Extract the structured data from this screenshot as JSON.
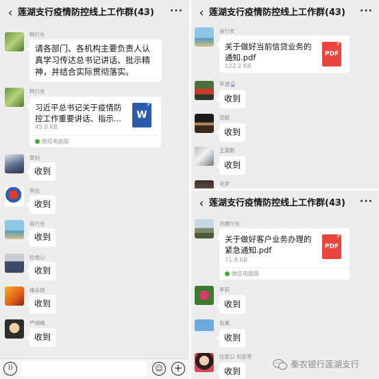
{
  "chat_title": "莲湖支行疫情防控线上工作群(43)",
  "icons": {
    "back": "chevron-left-icon",
    "mute": "mute-bell-icon",
    "more": "more-dots-icon",
    "voice": "voice-icon",
    "emoji": "emoji-icon",
    "plus": "plus-icon",
    "word_file": "word-file-icon",
    "pdf_file": "pdf-file-icon",
    "wechat_pc": "wechat-pc-icon"
  },
  "colors": {
    "chat_background": "#ededed",
    "bubble": "#ffffff",
    "pdf_red": "#e8453c",
    "word_blue": "#2b5cab",
    "wechat_green": "#3cb034"
  },
  "left_panel": {
    "messages": [
      {
        "sender": "韩行长",
        "text": "请各部门、各机构主要负责人认真学习传达总书记讲话、批示精神，并结合实际贯彻落实。"
      },
      {
        "sender": "韩行长",
        "file": {
          "name": "习近平总书记关于疫情防控工作重要讲话、指示...",
          "size": "45.0 KB",
          "icon_label": "W",
          "source": "微信电脑版"
        }
      },
      {
        "sender": "黄钊",
        "text": "收到"
      },
      {
        "sender": "李欣",
        "text": "收到"
      },
      {
        "sender": "容行长",
        "text": "收到"
      },
      {
        "sender": "杜岐山",
        "text": "收到"
      },
      {
        "sender": "褚永刚",
        "text": "收到"
      },
      {
        "sender": "严旭峰",
        "text": "收到"
      }
    ]
  },
  "right_top_panel": {
    "messages": [
      {
        "sender": "容行长",
        "file": {
          "name": "关于做好当前信贷业务的通知.pdf",
          "size": "122.2 KB",
          "icon_label": "PDF"
        }
      },
      {
        "sender": "毕波🎡",
        "text": "收到"
      },
      {
        "sender": "党超",
        "text": "收到"
      },
      {
        "sender": "王震鹏",
        "text": "收到"
      },
      {
        "sender": "毛梦"
      }
    ]
  },
  "right_bottom_panel": {
    "messages": [
      {
        "sender": "刘建行长",
        "file": {
          "name": "关于做好客户业务办理的紧急通知.pdf",
          "size": "71.8 KB",
          "icon_label": "PDF",
          "source": "微信电脑版"
        }
      },
      {
        "sender": "李莉",
        "text": "收到"
      },
      {
        "sender": "岳寓",
        "text": "收到"
      },
      {
        "sender": "任家口 何亚萍",
        "text": "收到"
      }
    ]
  },
  "watermark": {
    "text": "秦农银行莲湖支行"
  }
}
